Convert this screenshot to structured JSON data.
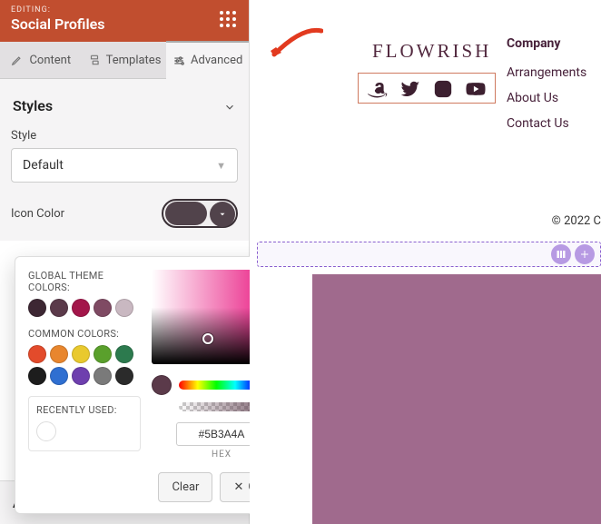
{
  "header": {
    "editing": "EDITING:",
    "title": "Social Profiles"
  },
  "tabs": {
    "content": "Content",
    "templates": "Templates",
    "advanced": "Advanced"
  },
  "styles_section": {
    "heading": "Styles",
    "style_label": "Style",
    "style_value": "Default",
    "icon_color_label": "Icon Color"
  },
  "attributes_section": {
    "heading": "Attributes"
  },
  "color_picker": {
    "global_label": "GLOBAL THEME COLORS:",
    "global": [
      "#3d2733",
      "#5b3a4a",
      "#a3164a",
      "#7f4a63",
      "#c9b8c1"
    ],
    "common_label": "COMMON COLORS:",
    "common_row1": [
      "#e34b2b",
      "#e8862e",
      "#e9c92e",
      "#5aa02c",
      "#2c7a4e",
      "#1d1d1d"
    ],
    "common_row2": [
      "#2f6fd1",
      "#6e3fae",
      "#7a7a7a",
      "#2b2b2b"
    ],
    "recently_label": "RECENTLY USED:",
    "hex_value": "#5B3A4A",
    "hex_label": "HEX",
    "clear": "Clear",
    "close": "Close"
  },
  "preview": {
    "brand": "FLOWRISH",
    "company_heading": "Company",
    "links": [
      "Arrangements",
      "About Us",
      "Contact Us"
    ],
    "copyright": "© 2022 C"
  }
}
